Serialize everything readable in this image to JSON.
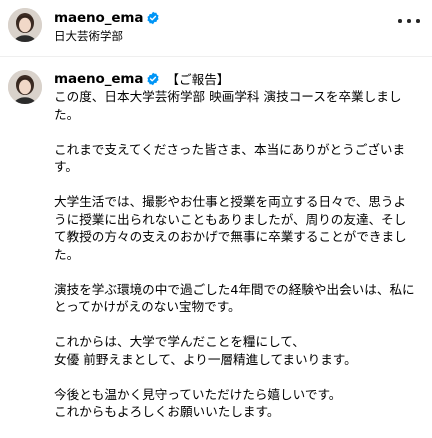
{
  "header": {
    "username": "maeno_ema",
    "subtitle": "日大芸術学部",
    "verified_icon": "verified-badge-icon",
    "more_icon": "more-options-icon"
  },
  "post": {
    "username": "maeno_ema",
    "tag": "【ご報告】",
    "paragraphs": [
      [
        "この度、日本大学芸術学部 映画学科 演技コースを卒業しまし",
        "た。"
      ],
      [
        "これまで支えてくださった皆さま、本当にありがとうございま",
        "す。"
      ],
      [
        "大学生活では、撮影やお仕事と授業を両立する日々で、思うよ",
        "うに授業に出られないこともありましたが、周りの友達、そし",
        "て教授の方々の支えのおかげで無事に卒業することができまし",
        "た。"
      ],
      [
        "演技を学ぶ環境の中で過ごした4年間での経験や出会いは、私に",
        "とってかけがえのない宝物です。"
      ],
      [
        "これからは、大学で学んだことを糧にして、",
        "女優 前野えまとして、より一層精進してまいります。"
      ],
      [
        "今後とも温かく見守っていただけたら嬉しいです。",
        "これからもよろしくお願いいたします。"
      ]
    ]
  },
  "colors": {
    "verified_blue": "#0095f6",
    "text": "#000000",
    "divider": "#efefef"
  }
}
